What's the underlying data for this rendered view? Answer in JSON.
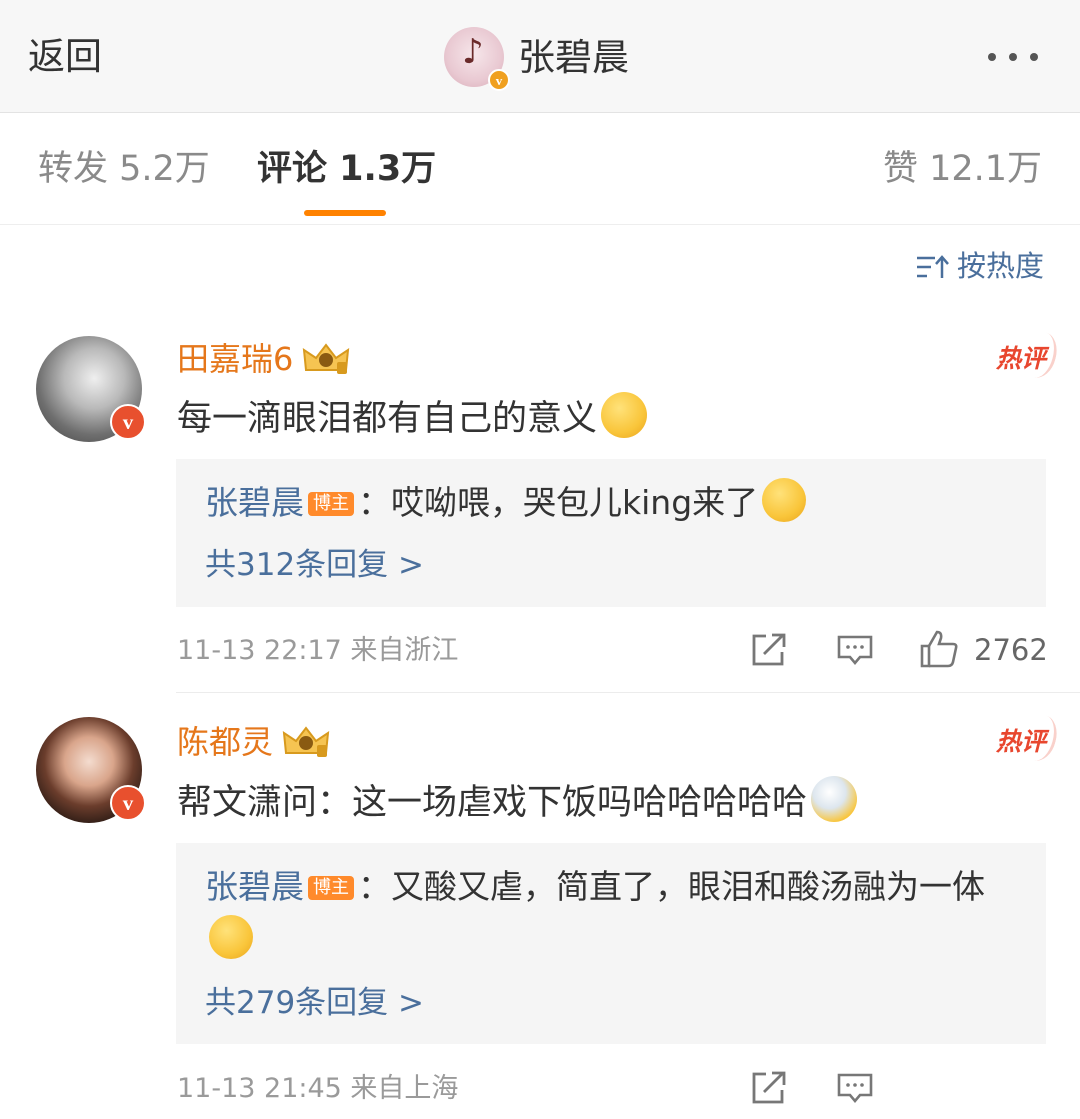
{
  "header": {
    "back_label": "返回",
    "title": "张碧晨"
  },
  "tabs": {
    "repost": "转发 5.2万",
    "comment": "评论 1.3万",
    "like": "赞 12.1万"
  },
  "sort": {
    "label": "按热度",
    "icon": "sort-icon"
  },
  "colors": {
    "accent_orange": "#ff8200",
    "link_blue": "#4a6f9c",
    "username_orange": "#e5771b",
    "hot_red": "#e8462e"
  },
  "comments": [
    {
      "username": "田嘉瑞6",
      "badge": "热评",
      "text": "每一滴眼泪都有自己的意义",
      "emoji": "shush-face-emoji",
      "reply": {
        "author": "张碧晨",
        "tag": "博主",
        "text": "：哎呦喂，哭包儿king来了",
        "emoji": "blush-pray-emoji"
      },
      "reply_count": "共312条回复 >",
      "time": "11-13 22:17 来自浙江",
      "likes": "2762"
    },
    {
      "username": "陈都灵",
      "badge": "热评",
      "text": "帮文潇问：这一场虐戏下饭吗哈哈哈哈哈",
      "emoji": "eating-face-emoji",
      "reply": {
        "author": "张碧晨",
        "tag": "博主",
        "text": "：又酸又虐，简直了，眼泪和酸汤融为一体",
        "emoji": "crying-face-emoji"
      },
      "reply_count": "共279条回复 >",
      "time": "11-13 21:45 来自上海"
    }
  ]
}
